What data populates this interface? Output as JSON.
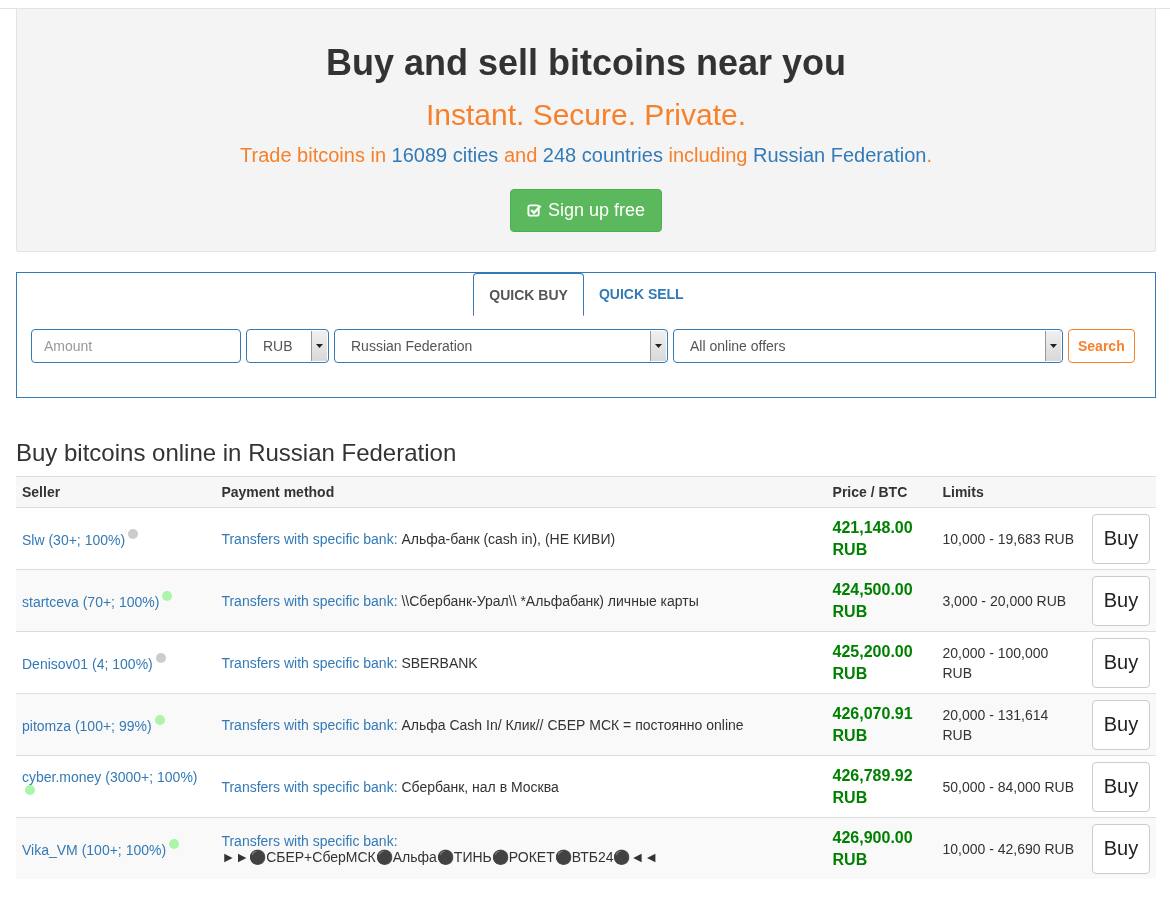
{
  "hero": {
    "title": "Buy and sell bitcoins near you",
    "subtitle": "Instant. Secure. Private.",
    "tagline": [
      {
        "text": "Trade bitcoins in ",
        "kind": "plain"
      },
      {
        "text": "16089 cities",
        "kind": "link"
      },
      {
        "text": " and ",
        "kind": "plain"
      },
      {
        "text": "248 countries",
        "kind": "link"
      },
      {
        "text": " including ",
        "kind": "plain"
      },
      {
        "text": "Russian Federation",
        "kind": "link"
      },
      {
        "text": ".",
        "kind": "plain"
      }
    ],
    "signup_button": "Sign up free"
  },
  "tabs": [
    {
      "label": "QUICK BUY",
      "selected": true
    },
    {
      "label": "QUICK SELL",
      "selected": false
    }
  ],
  "search_form": {
    "amount_placeholder": "Amount",
    "currency": "RUB",
    "country": "Russian Federation",
    "offer_type": "All online offers",
    "search_button": "Search"
  },
  "section_title": "Buy bitcoins online in Russian Federation",
  "table": {
    "columns": [
      "Seller",
      "Payment method",
      "Price / BTC",
      "Limits"
    ],
    "rows": [
      {
        "seller": "Slw (30+; 100%)",
        "color": "#cccccc",
        "method": "Transfers with specific bank:",
        "details": "Альфа-банк (cash in), (НЕ КИВИ)",
        "price": "421,148.00 RUB",
        "limits": "10,000 - 19,683 RUB",
        "button": "Buy"
      },
      {
        "seller": "startceva (70+; 100%)",
        "color": "#a9f5a9",
        "method": "Transfers with specific bank:",
        "details": "\\\\Сбербанк-Урал\\\\ *Альфабанк) личные карты",
        "price": "424,500.00 RUB",
        "limits": "3,000 - 20,000 RUB",
        "button": "Buy"
      },
      {
        "seller": "Denisov01 (4; 100%)",
        "color": "#cccccc",
        "method": "Transfers with specific bank:",
        "details": "SBERBANK",
        "price": "425,200.00 RUB",
        "limits": "20,000 - 100,000 RUB",
        "button": "Buy"
      },
      {
        "seller": "pitomza (100+; 99%)",
        "color": "#a9f5a9",
        "method": "Transfers with specific bank:",
        "details": "Альфа Cash In/ Клик// СБЕР МСК = постоянно online",
        "price": "426,070.91 RUB",
        "limits": "20,000 - 131,614 RUB",
        "button": "Buy"
      },
      {
        "seller": "cyber.money (3000+; 100%)",
        "color": "#a9f5a9",
        "method": "Transfers with specific bank:",
        "details": "Сбербанк, нал в Москва",
        "price": "426,789.92 RUB",
        "limits": "50,000 - 84,000 RUB",
        "button": "Buy"
      },
      {
        "seller": "Vika_VM (100+; 100%)",
        "color": "#a9f5a9",
        "method": "Transfers with specific bank:",
        "details": "►►⚫СБЕР+СберМСК⚫Альфа⚫ТИНЬ⚫РОКЕТ⚫ВТБ24⚫◄◄",
        "price": "426,900.00 RUB",
        "limits": "10,000 - 42,690 RUB",
        "button": "Buy"
      }
    ]
  }
}
